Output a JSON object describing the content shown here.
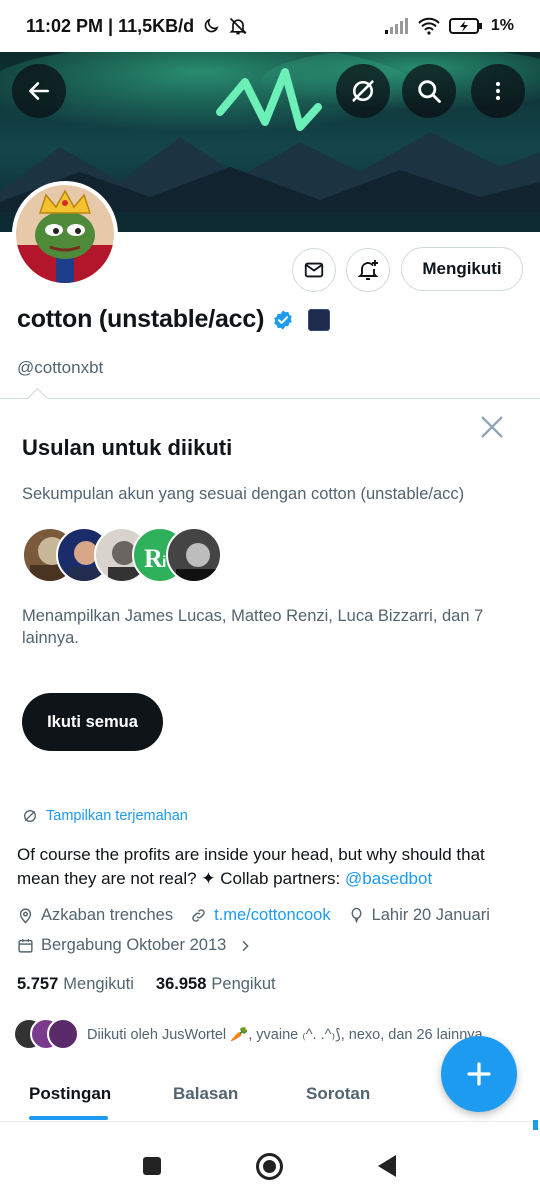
{
  "status_bar": {
    "time_and_speed": "11:02 PM | 11,5KB/d",
    "battery": "1%"
  },
  "profile": {
    "name": "cotton (unstable/acc)",
    "handle": "@cottonxbt",
    "follow_button": "Mengikuti",
    "bio_text": "Of course the profits are inside your head, but why should that mean they are not real? ✦ Collab partners: ",
    "bio_mention": "@basedbot",
    "translate": "Tampilkan terjemahan",
    "location": "Azkaban trenches",
    "website": "t.me/cottoncook",
    "birthday": "Lahir 20 Januari",
    "joined": "Bergabung Oktober 2013",
    "following_count": "5.757",
    "following_label": "Mengikuti",
    "followers_count": "36.958",
    "followers_label": "Pengikut",
    "followed_by": "Diikuti oleh JusWortel 🥕, yvaine ₍^. .^₎⟆, nexo, dan 26 lainnya"
  },
  "suggestions": {
    "title": "Usulan untuk diikuti",
    "subtitle": "Sekumpulan akun yang sesuai dengan cotton (unstable/acc)",
    "showing": "Menampilkan James Lucas, Matteo Renzi, Luca Bizzarri, dan 7 lainnya.",
    "follow_all": "Ikuti semua"
  },
  "tabs": [
    {
      "label": "Postingan"
    },
    {
      "label": "Balasan"
    },
    {
      "label": "Sorotan"
    }
  ],
  "colors": {
    "accent": "#1d9bf0",
    "text": "#0f1419",
    "muted": "#536471"
  }
}
